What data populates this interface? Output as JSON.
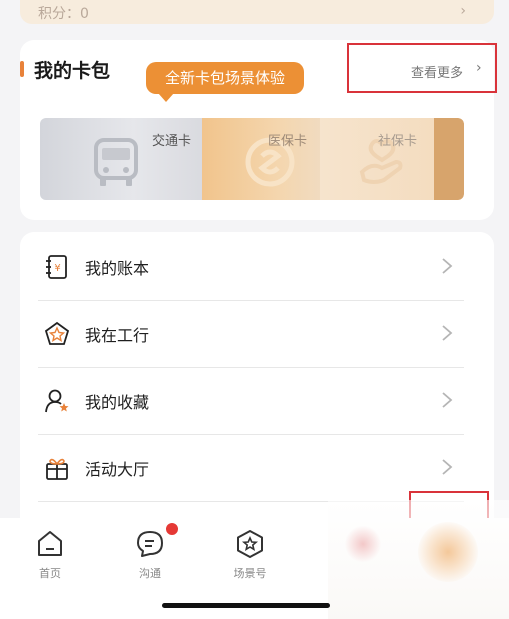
{
  "points": {
    "label": "积分：0",
    "chevron": "›"
  },
  "wallet": {
    "title": "我的卡包",
    "see_more": "查看更多",
    "see_more_chevron": "›",
    "tooltip": "全新卡包场景体验",
    "cards": [
      {
        "label": "交通卡",
        "icon": "bus-icon"
      },
      {
        "label": "医保卡",
        "icon": "social-insurance-icon"
      },
      {
        "label": "社保卡",
        "icon": "hand-care-icon"
      }
    ]
  },
  "menu": {
    "items": [
      {
        "label": "我的账本",
        "icon": "ledger-icon"
      },
      {
        "label": "我在工行",
        "icon": "star-gem-icon"
      },
      {
        "label": "我的收藏",
        "icon": "favorite-user-icon"
      },
      {
        "label": "活动大厅",
        "icon": "gift-icon"
      }
    ]
  },
  "tabbar": {
    "tabs": [
      {
        "label": "首页",
        "icon": "home-icon"
      },
      {
        "label": "沟通",
        "icon": "chat-icon",
        "badge": true
      },
      {
        "label": "场景号",
        "icon": "star-hexagon-icon"
      }
    ]
  },
  "colors": {
    "accent": "#ec9035",
    "highlight_box": "#d9333a",
    "badge": "#e53935"
  }
}
